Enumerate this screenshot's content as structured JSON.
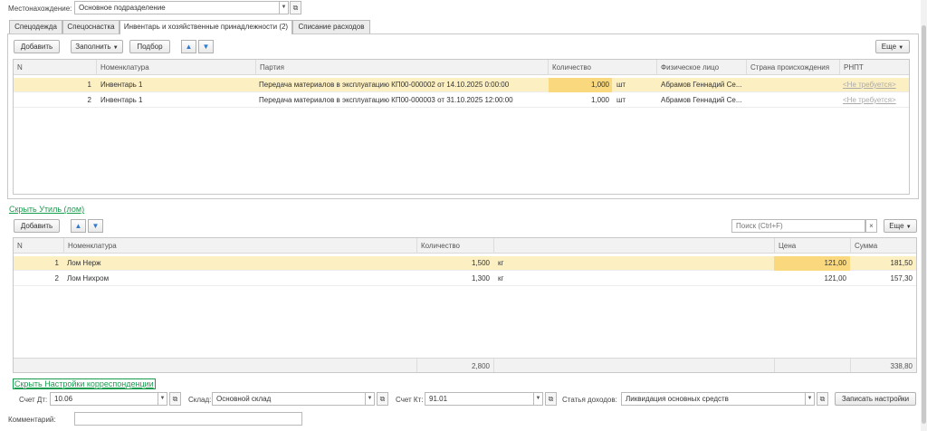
{
  "location": {
    "label": "Местонахождение:",
    "value": "Основное подразделение"
  },
  "tabs": [
    {
      "label": "Спецодежда"
    },
    {
      "label": "Спецоснастка"
    },
    {
      "label": "Инвентарь и хозяйственные принадлежности (2)"
    },
    {
      "label": "Списание расходов"
    }
  ],
  "inv_toolbar": {
    "add": "Добавить",
    "fill": "Заполнить",
    "select": "Подбор",
    "more": "Еще"
  },
  "inv_table": {
    "columns": {
      "n": "N",
      "nomenclature": "Номенклатура",
      "batch": "Партия",
      "qty": "Количество",
      "person": "Физическое лицо",
      "country": "Страна происхождения",
      "rnpt": "РНПТ"
    },
    "rows": [
      {
        "n": "1",
        "nomenclature": "Инвентарь 1",
        "batch": "Передача материалов в эксплуатацию КП00-000002 от 14.10.2025 0:00:00",
        "qty": "1,000",
        "unit": "шт",
        "person": "Абрамов Геннадий Се...",
        "country": "",
        "rnpt": "<Не требуется>"
      },
      {
        "n": "2",
        "nomenclature": "Инвентарь 1",
        "batch": "Передача материалов в эксплуатацию КП00-000003 от 31.10.2025 12:00:00",
        "qty": "1,000",
        "unit": "шт",
        "person": "Абрамов Геннадий Се...",
        "country": "",
        "rnpt": "<Не требуется>"
      }
    ]
  },
  "scrap_link": "Скрыть Утиль (лом)",
  "scrap_toolbar": {
    "add": "Добавить",
    "search_placeholder": "Поиск (Ctrl+F)",
    "more": "Еще"
  },
  "scrap_table": {
    "columns": {
      "n": "N",
      "nomenclature": "Номенклатура",
      "qty": "Количество",
      "price": "Цена",
      "sum": "Сумма"
    },
    "rows": [
      {
        "n": "1",
        "nomenclature": "Лом Нерж",
        "qty": "1,500",
        "unit": "кг",
        "price": "121,00",
        "sum": "181,50"
      },
      {
        "n": "2",
        "nomenclature": "Лом Нихром",
        "qty": "1,300",
        "unit": "кг",
        "price": "121,00",
        "sum": "157,30"
      }
    ],
    "footer": {
      "qty": "2,800",
      "sum": "338,80"
    }
  },
  "corr_link": "Скрыть Настройки корреспонденции",
  "corr": {
    "dt_label": "Счет Дт:",
    "dt_value": "10.06",
    "warehouse_label": "Склад:",
    "warehouse_value": "Основной склад",
    "kt_label": "Счет Кт:",
    "kt_value": "91.01",
    "income_label": "Статья доходов:",
    "income_value": "Ликвидация основных средств",
    "save_button": "Записать настройки"
  },
  "comment_label": "Комментарий:"
}
